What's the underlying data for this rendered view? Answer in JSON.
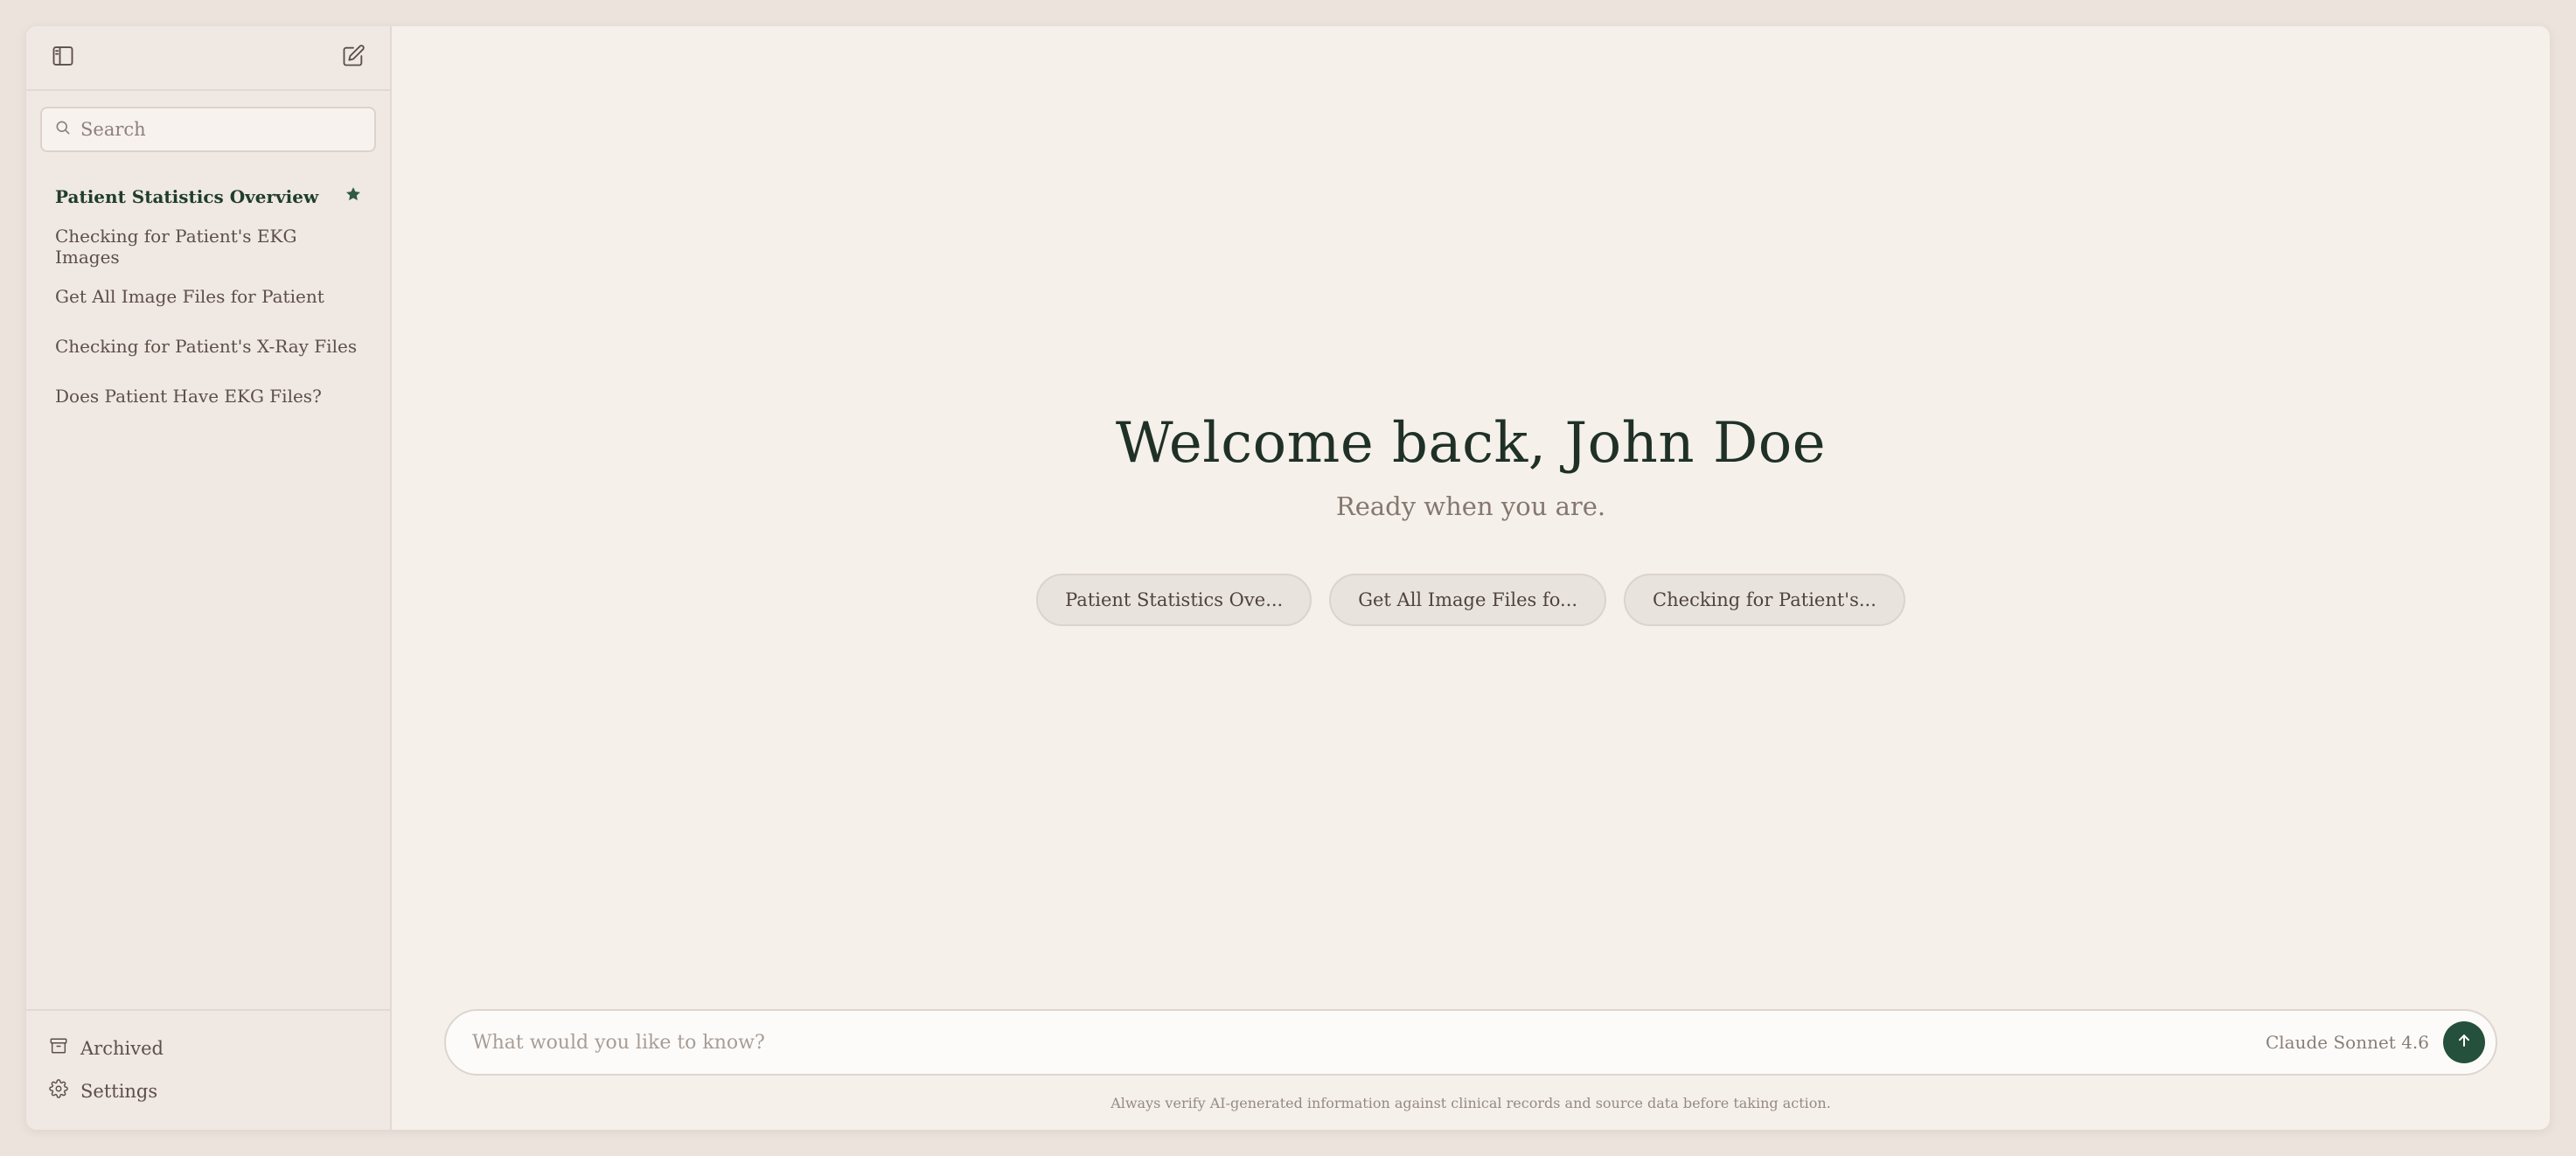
{
  "sidebar": {
    "search_placeholder": "Search",
    "conversations": [
      {
        "label": "Patient Statistics Overview",
        "active": true,
        "starred": true
      },
      {
        "label": "Checking for Patient's EKG Images"
      },
      {
        "label": "Get All Image Files for Patient"
      },
      {
        "label": "Checking for Patient's X-Ray Files"
      },
      {
        "label": "Does Patient Have EKG Files?"
      }
    ],
    "bottom": {
      "archived_label": "Archived",
      "settings_label": "Settings"
    }
  },
  "main": {
    "welcome_title": "Welcome back, John Doe",
    "welcome_subtitle": "Ready when you are.",
    "suggestions": [
      "Patient Statistics Ove...",
      "Get All Image Files fo...",
      "Checking for Patient's..."
    ],
    "composer": {
      "placeholder": "What would you like to know?",
      "model_label": "Claude Sonnet 4.6"
    },
    "disclaimer": "Always verify AI-generated information against clinical records and source data before taking action."
  },
  "colors": {
    "accent": "#25503b",
    "star": "#2f5a44",
    "active_text": "#1f3d2e"
  },
  "icons": {
    "sidebar_toggle": "sidebar-toggle-icon",
    "new_chat": "edit-icon",
    "search": "search-icon",
    "star": "star-icon",
    "archive": "archive-icon",
    "settings": "gear-icon",
    "send": "arrow-up-icon"
  }
}
